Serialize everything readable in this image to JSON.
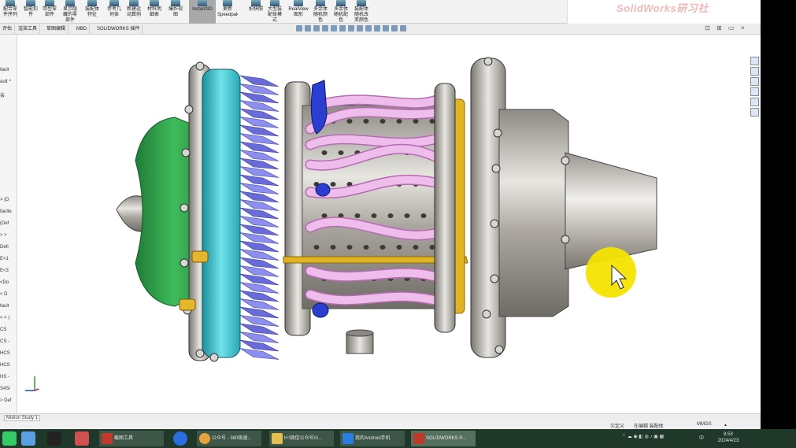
{
  "ribbon": {
    "buttons": [
      {
        "label": "配合零\n件序列"
      },
      {
        "label": "智能扣\n件"
      },
      {
        "label": "带型零\n部件"
      },
      {
        "label": "显示隐\n藏的零\n部件"
      },
      {
        "label": "装配体\n特征"
      },
      {
        "label": "参考几\n何体"
      },
      {
        "label": "新建运\n动算例"
      },
      {
        "label": "材料明\n细表"
      },
      {
        "label": "爆炸视\n图"
      },
      {
        "label": "Instant3D"
      },
      {
        "label": "更新\nSpeedpak"
      },
      {
        "label": "拍快照"
      },
      {
        "label": "大型装\n配体模\n式"
      },
      {
        "label": "RealView\n图形"
      },
      {
        "label": "多余体\n随机颜\n色"
      },
      {
        "label": "多余体\n随机配\n色"
      },
      {
        "label": "装配体\n随机改\n变颜色"
      }
    ],
    "watermark": "SolidWorks研习社"
  },
  "tabs": [
    "评估",
    "渲染工具",
    "草图编辑",
    "MBD",
    "SOLIDWORKS 插件"
  ],
  "window_controls": [
    "⊡",
    "⊞",
    "▭",
    "×"
  ],
  "left_tree": [
    "fault",
    "ault ^",
    "会",
    "> (D",
    "faulte",
    "(Def",
    "> >",
    "Defi",
    "E<1",
    "E<3",
    "<Do",
    "< D",
    "fault",
    "< < (",
    "CS",
    "CS -",
    "HCS",
    "HCS",
    "HS -",
    "S4S/",
    "> Def",
    "E< (",
    "<De",
    "Def",
    "Def"
  ],
  "model": {
    "name": "jet engine assembly"
  },
  "bottom_tab": "Motion Study 1",
  "status": {
    "left": "欠定义",
    "mode": "在编辑 装配体",
    "units": "MMGS",
    "arrow": "▴"
  },
  "taskbar": {
    "apps": [
      {
        "label": "截图工具",
        "color": "#c0392b"
      },
      {
        "label": "公众号 - 360极速...",
        "color": "#e8a33d"
      },
      {
        "label": "H:\\微信公众号\\0...",
        "color": "#e5c04c"
      },
      {
        "label": "我的Android手机",
        "color": "#2a7de1"
      },
      {
        "label": "SOLIDWORKS P...",
        "color": "#c0392b"
      }
    ],
    "time": "8:53",
    "date": "2024/4/23",
    "lang": "中"
  },
  "colors": {
    "inlet": "#2e9e4a",
    "fan_ring": "#3fc3d0",
    "fan_blades": "#7c7ce8",
    "tubes": "#e5a2e0",
    "ring_gold": "#e0b320",
    "steel": "#b8b4ad",
    "cursor_halo": "#f5e400"
  }
}
